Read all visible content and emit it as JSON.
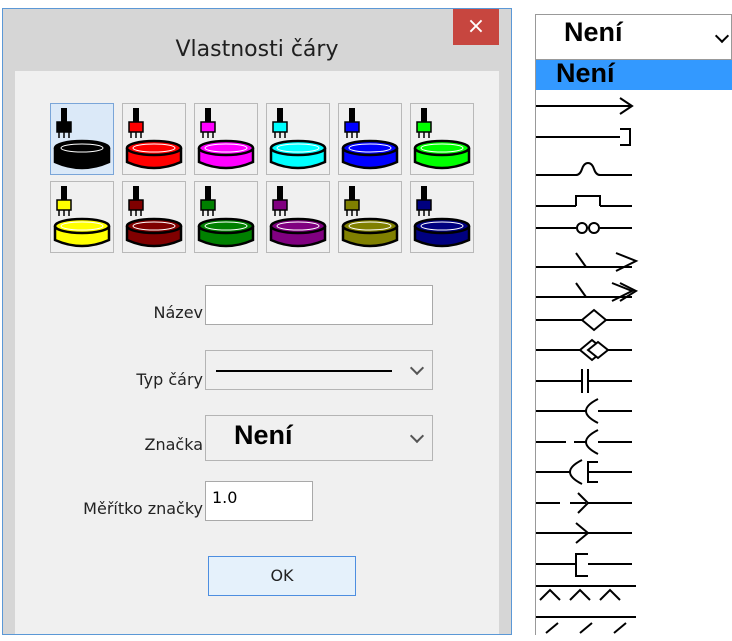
{
  "dialog": {
    "title": "Vlastnosti čáry",
    "close_label": "×",
    "swatches": [
      {
        "color": "#000000",
        "brush": "#000000"
      },
      {
        "color": "#ff0000",
        "brush": "#ff0000"
      },
      {
        "color": "#ff00ff",
        "brush": "#ff00ff"
      },
      {
        "color": "#00ffff",
        "brush": "#00ffff"
      },
      {
        "color": "#0000ff",
        "brush": "#0000ff"
      },
      {
        "color": "#00ff00",
        "brush": "#00ff00"
      },
      {
        "color": "#ffff00",
        "brush": "#ffff00"
      },
      {
        "color": "#800000",
        "brush": "#800000"
      },
      {
        "color": "#008000",
        "brush": "#008000"
      },
      {
        "color": "#800080",
        "brush": "#800080"
      },
      {
        "color": "#808000",
        "brush": "#808000"
      },
      {
        "color": "#000080",
        "brush": "#000080"
      }
    ],
    "selected_swatch": 0,
    "name_label": "Název",
    "name_value": "",
    "linetype_label": "Typ čáry",
    "symbol_label": "Značka",
    "symbol_value": "Není",
    "scale_label": "Měřítko značky",
    "scale_value": "1.0",
    "ok_label": "OK"
  },
  "dropdown": {
    "value": "Není",
    "selected_item": "Není",
    "items": [
      "arrow",
      "bracket",
      "s-curve",
      "step",
      "infinity",
      "double-arrow",
      "triple-arrow",
      "open-diamond",
      "double-diamond",
      "capacitor",
      "socket",
      "dash-socket",
      "plug-socket",
      "dash-fork",
      "fork",
      "bracket-2",
      "hatch-up",
      "hatch-down"
    ]
  }
}
